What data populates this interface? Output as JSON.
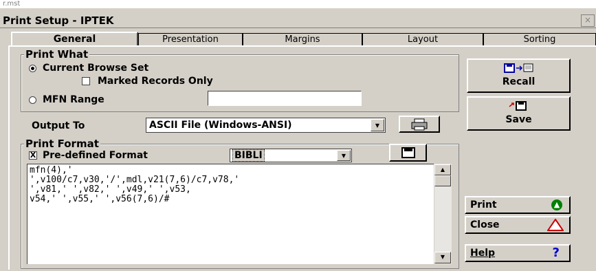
{
  "parent_window": {
    "title": "r.mst"
  },
  "window": {
    "title": "Print Setup - IPTEK",
    "close_label": "×"
  },
  "tabs": [
    {
      "label": "General"
    },
    {
      "label": "Presentation"
    },
    {
      "label": "Margins"
    },
    {
      "label": "Layout"
    },
    {
      "label": "Sorting"
    }
  ],
  "print_what": {
    "legend": "Print What",
    "current_browse_set": "Current Browse Set",
    "marked_records_only": "Marked Records Only",
    "mfn_range": "MFN Range",
    "mfn_range_value": ""
  },
  "output_to": {
    "label": "Output To",
    "value": "ASCII File (Windows-ANSI)"
  },
  "print_format": {
    "legend": "Print Format",
    "predefined_label": "Pre-defined Format",
    "predefined_checked": "X",
    "format_value": "BIBLI",
    "format_text": "mfn(4),'\n',v100/c7,v30,'/',mdl,v21(7,6)/c7,v78,'\n',v81,' ',v82,' ',v49,' ',v53,\nv54,' ',v55,' ',v56(7,6)/#"
  },
  "buttons": {
    "recall": "Recall",
    "save": "Save",
    "print": "Print",
    "close": "Close",
    "help": "Help"
  },
  "icons": {
    "help_glyph": "?",
    "check_glyph": "✓"
  },
  "colors": {
    "print_icon": "#008000",
    "close_icon": "#cc0000",
    "help_icon": "#0000cc"
  }
}
